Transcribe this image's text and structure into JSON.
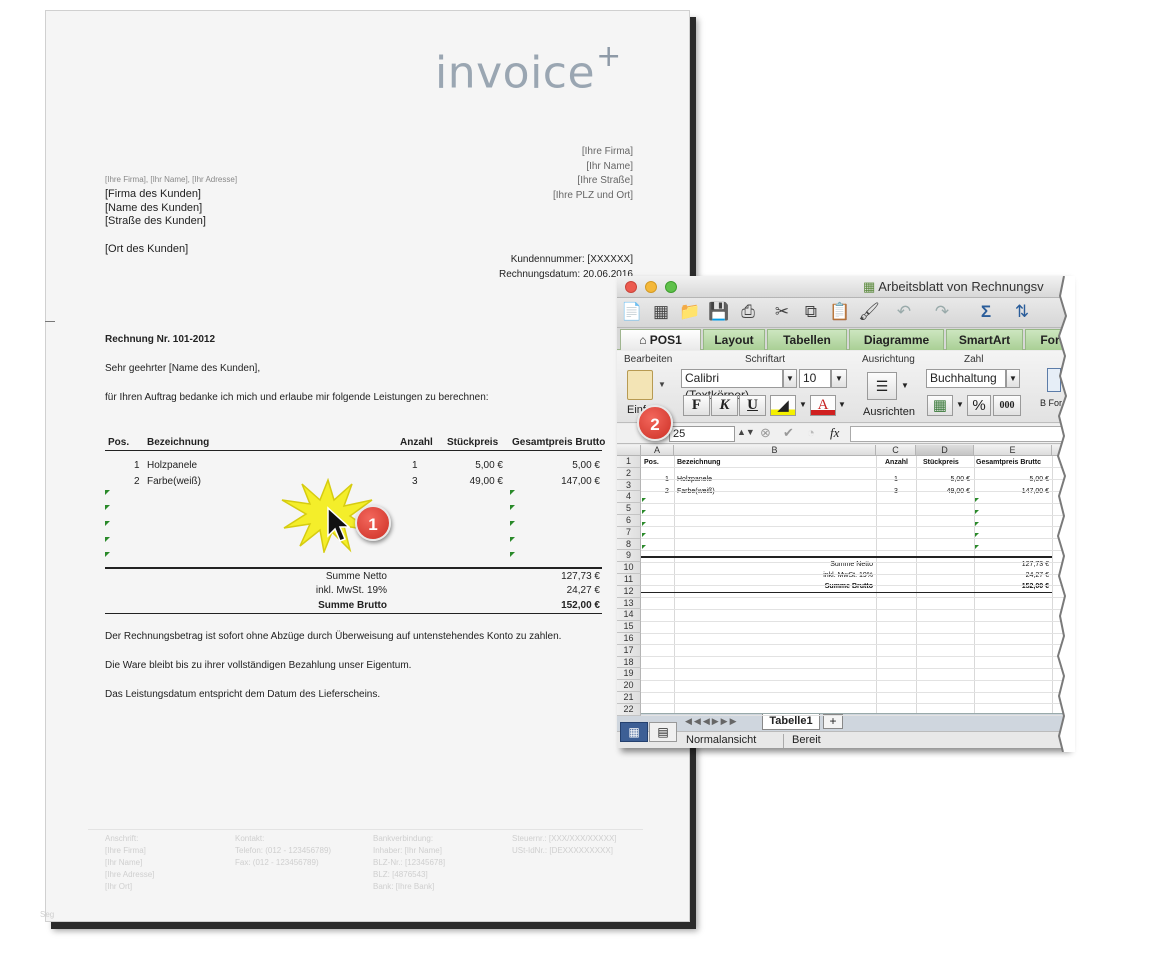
{
  "logo": {
    "text": "invoice",
    "plus": "+"
  },
  "sender": {
    "line_small": "[Ihre Firma], [Ihr Name], [Ihr Adresse]",
    "company": "[Ihre Firma]",
    "name": "[Ihr Name]",
    "street": "[Ihre Straße]",
    "city": "[Ihre PLZ und Ort]"
  },
  "recipient": {
    "company": "[Firma des Kunden]",
    "name": "[Name des Kunden]",
    "street": "[Straße des Kunden]",
    "city": "[Ort des Kunden]"
  },
  "meta": {
    "customer_no": "Kundennummer: [XXXXXX]",
    "date": "Rechnungsdatum: 20.06.2016"
  },
  "invoice": {
    "title": "Rechnung Nr. 101-2012",
    "greeting": "Sehr geehrter [Name des Kunden],",
    "intro": "für Ihren Auftrag bedanke ich mich und erlaube mir folgende Leistungen zu berechnen:",
    "headers": {
      "pos": "Pos.",
      "desc": "Bezeichnung",
      "qty": "Anzahl",
      "unit": "Stückpreis",
      "total": "Gesamtpreis Brutto"
    },
    "items": [
      {
        "pos": "1",
        "desc": "Holzpanele",
        "qty": "1",
        "unit": "5,00 €",
        "total": "5,00 €"
      },
      {
        "pos": "2",
        "desc": "Farbe(weiß)",
        "qty": "3",
        "unit": "49,00 €",
        "total": "147,00 €"
      }
    ],
    "net_label": "Summe Netto",
    "net": "127,73 €",
    "vat_label": "inkl. MwSt. 19%",
    "vat": "24,27 €",
    "gross_label": "Summe Brutto",
    "gross": "152,00 €",
    "note1": "Der Rechnungsbetrag ist sofort ohne Abzüge durch Überweisung auf untenstehendes Konto zu zahlen.",
    "note2": "Die Ware bleibt bis zu ihrer vollständigen Bezahlung unser Eigentum.",
    "note3": "Das Leistungsdatum entspricht dem Datum des Lieferscheins."
  },
  "footer": {
    "col1": [
      "Anschrift:",
      "[Ihre Firma]",
      "[Ihr Name]",
      "[Ihre Adresse]",
      "[Ihr Ort]"
    ],
    "col2": [
      "Kontakt:",
      "Telefon: (012 - 123456789)",
      "Fax: (012 - 123456789)"
    ],
    "col3": [
      "Bankverbindung:",
      "Inhaber: [Ihr Name]",
      "BLZ-Nr.: [12345678]",
      "BLZ: [4876543]",
      "Bank: [Ihre Bank]"
    ],
    "col4": [
      "Steuernr.: [XXX/XXX/XXXXX]",
      "USt-IdNr.: [DEXXXXXXXXX]"
    ],
    "page_mark": "Seg"
  },
  "badges": {
    "one": "1",
    "two": "2"
  },
  "excel": {
    "window_title": "Arbeitsblatt von Rechnungsv",
    "tabs": [
      "POS1",
      "Layout",
      "Tabellen",
      "Diagramme",
      "SmartArt",
      "For"
    ],
    "groups": {
      "edit": "Bearbeiten",
      "font": "Schriftart",
      "align": "Ausrichtung",
      "number": "Zahl"
    },
    "font_name": "Calibri (Textkörper)",
    "font_size": "10",
    "number_format": "Buchhaltung",
    "paste_label": "Einf",
    "align_label": "Ausrichten",
    "format_label": "B For",
    "bold": "F",
    "italic": "K",
    "underline": "U",
    "percent": "%",
    "thousands": "000",
    "cell_ref": "25",
    "fx": "fx",
    "columns": [
      "A",
      "B",
      "C",
      "D",
      "E"
    ],
    "rows": [
      "1",
      "2",
      "3",
      "4",
      "5",
      "6",
      "7",
      "8",
      "9",
      "10",
      "11",
      "12",
      "13",
      "14",
      "15",
      "16",
      "17",
      "18",
      "19",
      "20",
      "21",
      "22"
    ],
    "header_row": {
      "a": "Pos.",
      "b": "Bezeichnung",
      "c": "Anzahl",
      "d": "Stückpreis",
      "e": "Gesamtpreis Bruttc"
    },
    "data_rows": [
      {
        "a": "1",
        "b": "Holzpanele",
        "c": "1",
        "d": "5,00 €",
        "e": "5,00 €"
      },
      {
        "a": "2",
        "b": "Farbe(weiß)",
        "c": "3",
        "d": "49,00 €",
        "e": "147,00 €"
      }
    ],
    "sum_rows": [
      {
        "label": "Summe Netto",
        "value": "127,73 €"
      },
      {
        "label": "inkl. MwSt. 19%",
        "value": "24,27 €"
      },
      {
        "label": "Summe Brutto",
        "value": "152,00 €"
      }
    ],
    "sheet_tab": "Tabelle1",
    "add_sheet": "+",
    "status_view": "Normalansicht",
    "status_ready": "Bereit"
  }
}
